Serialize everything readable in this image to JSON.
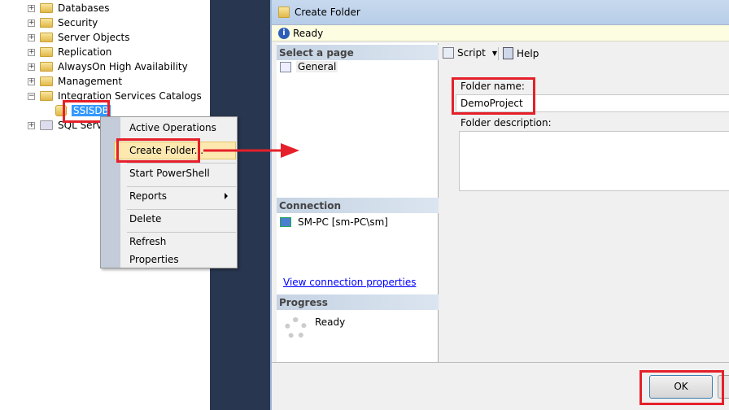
{
  "tree": {
    "items": [
      {
        "label": "Databases",
        "expander": "+"
      },
      {
        "label": "Security",
        "expander": "+"
      },
      {
        "label": "Server Objects",
        "expander": "+"
      },
      {
        "label": "Replication",
        "expander": "+"
      },
      {
        "label": "AlwaysOn High Availability",
        "expander": "+"
      },
      {
        "label": "Management",
        "expander": "+"
      },
      {
        "label": "Integration Services Catalogs",
        "expander": "−"
      }
    ],
    "selected": "SSISDB",
    "agent": "SQL Serve"
  },
  "context_menu": {
    "items": [
      "Active Operations",
      "Create Folder...",
      "Start PowerShell",
      "Reports",
      "Delete",
      "Refresh",
      "Properties"
    ]
  },
  "dialog": {
    "title": "Create Folder",
    "status": "Ready",
    "select_page": "Select a page",
    "page_general": "General",
    "connection_header": "Connection",
    "connection": "SM-PC [sm-PC\\sm]",
    "view_connection": "View connection properties",
    "progress_header": "Progress",
    "progress_status": "Ready",
    "script": "Script",
    "help": "Help",
    "folder_name_label": "Folder name:",
    "folder_name_value": "DemoProject",
    "folder_desc_label": "Folder description:",
    "ok": "OK"
  },
  "colors": {
    "highlight": "#e5202a",
    "selection": "#3399ff",
    "link": "#0000ff"
  }
}
